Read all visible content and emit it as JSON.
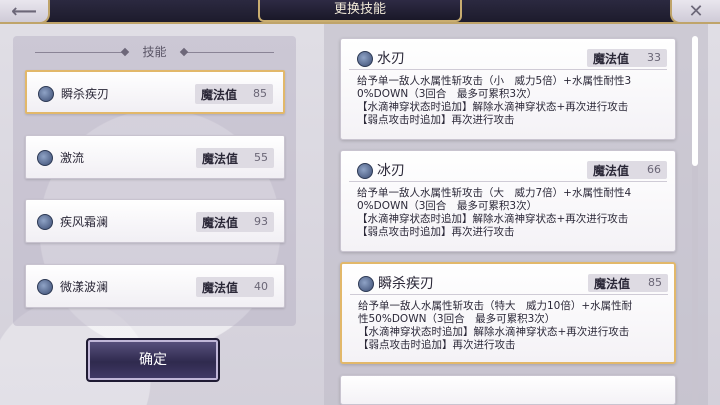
{
  "header": {
    "title": "更换技能"
  },
  "left_panel": {
    "title": "技能",
    "cost_label": "魔法值",
    "skills": [
      {
        "name": "瞬杀疾刃",
        "cost": "85"
      },
      {
        "name": "激流",
        "cost": "55"
      },
      {
        "name": "疾风霜澜",
        "cost": "93"
      },
      {
        "name": "微漾波澜",
        "cost": "40"
      }
    ]
  },
  "confirm_label": "确定",
  "skill_list": {
    "cost_label": "魔法值",
    "cards": [
      {
        "name": "水刃",
        "cost": "33",
        "desc": [
          "给予单一敌人水属性斩攻击（小　威力5倍）+水属性耐性3",
          "0%DOWN（3回合　最多可累积3次）",
          "【水滴神穿状态时追加】解除水滴神穿状态+再次进行攻击",
          "【弱点攻击时追加】再次进行攻击"
        ]
      },
      {
        "name": "冰刃",
        "cost": "66",
        "desc": [
          "给予单一敌人水属性斩攻击（大　威力7倍）+水属性耐性4",
          "0%DOWN（3回合　最多可累积3次）",
          "【水滴神穿状态时追加】解除水滴神穿状态+再次进行攻击",
          "【弱点攻击时追加】再次进行攻击"
        ]
      },
      {
        "name": "瞬杀疾刃",
        "cost": "85",
        "desc": [
          "给予单一敌人水属性斩攻击（特大　威力10倍）+水属性耐",
          "性50%DOWN（3回合　最多可累积3次）",
          "【水滴神穿状态时追加】解除水滴神穿状态+再次进行攻击",
          "【弱点攻击时追加】再次进行攻击"
        ]
      }
    ]
  },
  "icons": {
    "back": "back-arrow-icon",
    "close": "close-icon",
    "skill": "water-orb-icon"
  }
}
